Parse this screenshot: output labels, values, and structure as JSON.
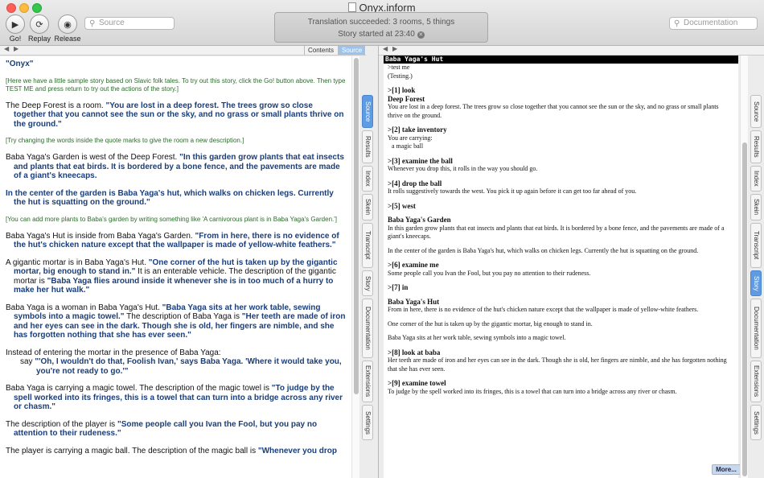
{
  "window": {
    "title": "Onyx.inform"
  },
  "toolbar": {
    "go_label": "Go!",
    "replay_label": "Replay",
    "release_label": "Release",
    "source_search_placeholder": "Source",
    "documentation_search_placeholder": "Documentation"
  },
  "status": {
    "line1": "Translation succeeded: 3 rooms, 5 things",
    "line2": "Story started at 23:40"
  },
  "left_pane": {
    "header_tabs": [
      "Contents",
      "Source"
    ],
    "selected_header_tab": "Source",
    "side_tabs": [
      "Source",
      "Results",
      "Index",
      "Skein",
      "Transcript",
      "Story",
      "Documentation",
      "Extensions",
      "Settings"
    ],
    "selected_side_tab": "Source",
    "source": {
      "title": "\"Onyx\"",
      "comment1": "[Here we have a little sample story based on Slavic folk tales. To try out this story, click the Go! button above. Then type TEST ME and press return to try out the actions of the story.]",
      "p1_plain": "The Deep Forest is a room. ",
      "p1_quote": "\"You are lost in a deep forest. The trees grow so close together that you cannot see the sun or the sky, and no grass or small plants thrive on the ground.\"",
      "comment2": "[Try changing the words inside the quote marks to give the room a new description.]",
      "p2_plain": "Baba Yaga's Garden is west of the Deep Forest. ",
      "p2_quote": "\"In this garden grow plants that eat insects and plants that eat birds. It is bordered by a bone fence, and the pavements are made of a giant's kneecaps.",
      "p3_quote": "In the center of the garden is Baba Yaga's hut, which walks on chicken legs. Currently the hut is squatting on the ground.\"",
      "comment3": "[You can add more plants to Baba's garden by writing something like 'A carnivorous plant is in Baba Yaga's Garden.']",
      "p4_plain": "Baba Yaga's Hut is inside from Baba Yaga's Garden. ",
      "p4_quote": "\"From in here, there is no evidence of the hut's chicken nature except that the wallpaper is made of yellow-white feathers.\"",
      "p5_plain1": "A gigantic mortar is in Baba Yaga's Hut. ",
      "p5_quote1": "\"One corner of the hut is taken up by the gigantic mortar, big enough to stand in.\"",
      "p5_plain2": " It is an enterable vehicle. The description of the gigantic mortar is ",
      "p5_quote2": "\"Baba Yaga flies around inside it whenever she is in too much of a hurry to make her hut walk.\"",
      "p6_plain1": "Baba Yaga is a woman in Baba Yaga's Hut. ",
      "p6_quote1": "\"Baba Yaga sits at her work table, sewing symbols into a magic towel.\"",
      "p6_plain2": " The description of Baba Yaga is ",
      "p6_quote2": "\"Her teeth are made of iron and her eyes can see in the dark. Though she is old, her fingers are nimble, and she has forgotten nothing that she has ever seen.\"",
      "p7_plain": "Instead of entering the mortar in the presence of Baba Yaga:",
      "p7_say": "say ",
      "p7_quote": "\"'Oh, I wouldn't do that, Foolish Ivan,' says Baba Yaga. 'Where it would take you, you're not ready to go.'\"",
      "p8_plain1": "Baba Yaga is carrying a magic towel. The description of the magic towel is ",
      "p8_quote": "\"To judge by the spell worked into its fringes, this is a towel that can turn into a bridge across any river or chasm.\"",
      "p9_plain": "The description of the player is ",
      "p9_quote": "\"Some people call you Ivan the Fool, but you pay no attention to their rudeness.\"",
      "p10_plain": "The player is carrying a magic ball. The description of the magic ball is ",
      "p10_quote": "\"Whenever you drop"
    }
  },
  "right_pane": {
    "side_tabs": [
      "Source",
      "Results",
      "Index",
      "Skein",
      "Transcript",
      "Story",
      "Documentation",
      "Extensions",
      "Settings"
    ],
    "selected_side_tab": "Story",
    "status_line": "Baba Yaga's Hut",
    "transcript": {
      "t0a": ">test me",
      "t0b": "(Testing.)",
      "c1": ">[1] look",
      "r1_room": "Deep Forest",
      "r1_text": "You are lost in a deep forest. The trees grow so close together that you cannot see the sun or the sky, and no grass or small plants thrive on the ground.",
      "c2": ">[2] take inventory",
      "r2_text": "You are carrying:",
      "r2_item": "a magic ball",
      "c3": ">[3] examine the ball",
      "r3_text": "Whenever you drop this, it rolls in the way you should go.",
      "c4": ">[4] drop the ball",
      "r4_text": "It rolls suggestively towards the west. You pick it up again before it can get too far ahead of you.",
      "c5": ">[5] west",
      "r5_room": "Baba Yaga's Garden",
      "r5_text": "In this garden grow plants that eat insects and plants that eat birds. It is bordered by a bone fence, and the pavements are made of a giant's kneecaps.",
      "r5_text2": "In the center of the garden is Baba Yaga's hut, which walks on chicken legs. Currently the hut is squatting on the ground.",
      "c6": ">[6] examine me",
      "r6_text": "Some people call you Ivan the Fool, but you pay no attention to their rudeness.",
      "c7": ">[7] in",
      "r7_room": "Baba Yaga's Hut",
      "r7_text": "From in here, there is no evidence of the hut's chicken nature except that the wallpaper is made of yellow-white feathers.",
      "r7_text2": "One corner of the hut is taken up by the gigantic mortar, big enough to stand in.",
      "r7_text3": "Baba Yaga sits at her work table, sewing symbols into a magic towel.",
      "c8": ">[8] look at baba",
      "r8_text": "Her teeth are made of iron and her eyes can see in the dark. Though she is old, her fingers are nimble, and she has forgotten nothing that she has ever seen.",
      "c9": ">[9] examine towel",
      "r9_text": "To judge by the spell worked into its fringes, this is a towel that can turn into a bridge across any river or chasm."
    },
    "more_label": "More..."
  },
  "colors": {
    "quote_text": "#1a3e7a",
    "comment_text": "#2b6b2b",
    "selected_tab": "#5f9be3"
  }
}
